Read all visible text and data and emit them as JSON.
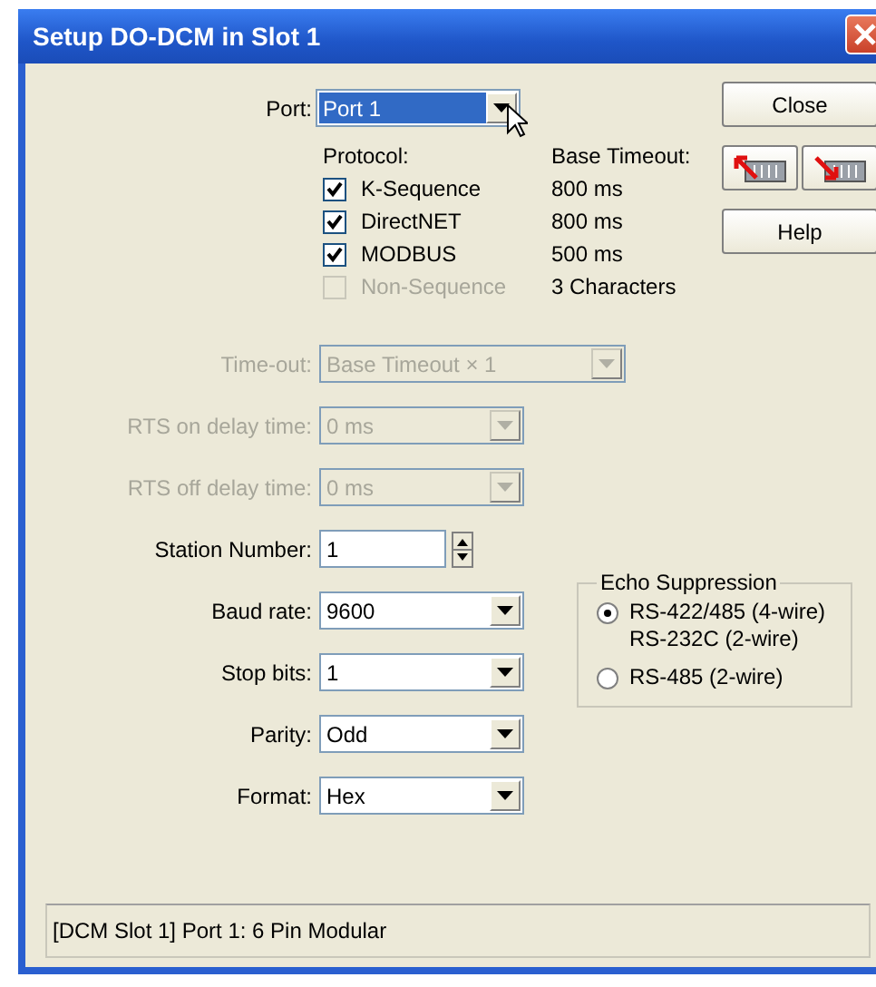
{
  "window": {
    "title": "Setup DO-DCM in Slot 1"
  },
  "port": {
    "label": "Port:",
    "value": "Port 1",
    "focused": true
  },
  "protocol": {
    "heading": "Protocol:",
    "timeout_heading": "Base Timeout:",
    "items": [
      {
        "label": "K-Sequence",
        "timeout": "800 ms",
        "checked": true,
        "disabled": false
      },
      {
        "label": "DirectNET",
        "timeout": "800 ms",
        "checked": true,
        "disabled": false
      },
      {
        "label": "MODBUS",
        "timeout": "500 ms",
        "checked": true,
        "disabled": false
      },
      {
        "label": "Non-Sequence",
        "timeout": "3 Characters",
        "checked": false,
        "disabled": true
      }
    ]
  },
  "buttons": [
    {
      "kind": "text",
      "label": "Close"
    },
    {
      "kind": "read-icon"
    },
    {
      "kind": "write-icon"
    },
    {
      "kind": "text",
      "label": "Help"
    }
  ],
  "fields": [
    {
      "kind": "wide-combo",
      "label": "Time-out:",
      "value": "Base Timeout × 1",
      "disabled": true
    },
    {
      "kind": "combo",
      "label": "RTS on delay time:",
      "value": "0 ms",
      "disabled": true
    },
    {
      "kind": "combo",
      "label": "RTS off delay time:",
      "value": "0 ms",
      "disabled": true
    },
    {
      "kind": "spinner",
      "label": "Station Number:",
      "value": "1",
      "disabled": false
    },
    {
      "kind": "combo",
      "label": "Baud rate:",
      "value": "9600",
      "disabled": false
    },
    {
      "kind": "combo",
      "label": "Stop bits:",
      "value": "1",
      "disabled": false
    },
    {
      "kind": "combo",
      "label": "Parity:",
      "value": "Odd",
      "disabled": false
    },
    {
      "kind": "combo",
      "label": "Format:",
      "value": "Hex",
      "disabled": false
    }
  ],
  "echo": {
    "title": "Echo Suppression",
    "options": [
      {
        "lines": [
          "RS-422/485 (4-wire)",
          "RS-232C (2-wire)"
        ],
        "selected": true
      },
      {
        "lines": [
          "RS-485 (2-wire)"
        ],
        "selected": false
      }
    ]
  },
  "status_bar": "[DCM Slot 1] Port 1: 6 Pin Modular"
}
